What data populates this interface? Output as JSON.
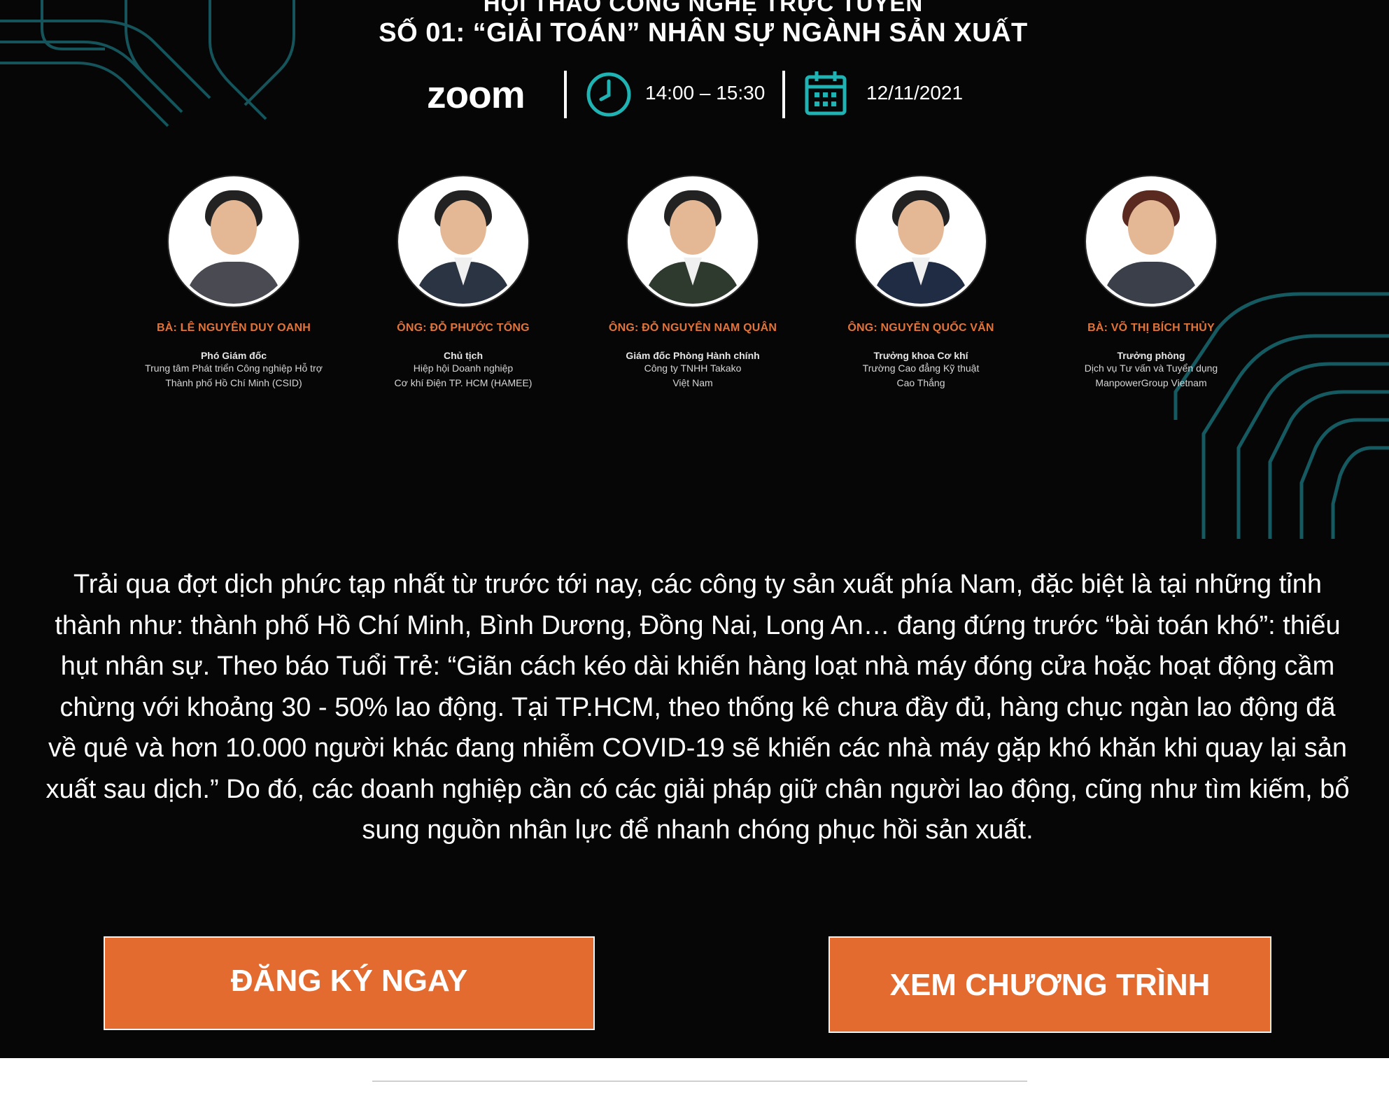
{
  "event": {
    "kicker": "HỘI THẢO CÔNG NGHỆ TRỰC TUYẾN",
    "title": "SỐ 01: “GIẢI TOÁN” NHÂN SỰ NGÀNH SẢN XUẤT",
    "platform": "zoom",
    "time": "14:00 – 15:30",
    "date": "12/11/2021"
  },
  "speakers": [
    {
      "name": "BÀ: LÊ NGUYÊN DUY OANH",
      "role": "Phó Giám đốc",
      "org_line1": "Trung tâm Phát triển Công nghiệp Hỗ trợ",
      "org_line2": "Thành phố Hồ Chí Minh (CSID)"
    },
    {
      "name": "ÔNG: ĐỖ PHƯỚC TỐNG",
      "role": "Chủ tịch",
      "org_line1": "Hiệp hội Doanh nghiệp",
      "org_line2": "Cơ khí Điện TP. HCM (HAMEE)"
    },
    {
      "name": "ÔNG: ĐỖ NGUYÊN NAM QUÂN",
      "role": "Giám đốc Phòng Hành chính",
      "org_line1": "Công ty TNHH Takako",
      "org_line2": "Việt Nam"
    },
    {
      "name": "ÔNG: NGUYỄN QUỐC VĂN",
      "role": "Trưởng khoa Cơ khí",
      "org_line1": "Trường Cao đẳng Kỹ thuật",
      "org_line2": "Cao Thắng"
    },
    {
      "name": "BÀ: VÕ THỊ BÍCH THỦY",
      "role": "Trưởng phòng",
      "org_line1": "Dịch vụ Tư vấn và Tuyển dụng",
      "org_line2": "ManpowerGroup Vietnam"
    }
  ],
  "intro_text": "Trải qua đợt dịch phức tạp nhất từ trước tới nay, các công ty sản xuất phía Nam, đặc biệt là tại những tỉnh thành như: thành phố Hồ Chí Minh, Bình Dương, Đồng Nai, Long An… đang đứng trước “bài toán khó”: thiếu hụt nhân sự. Theo báo Tuổi Trẻ: “Giãn cách kéo dài khiến hàng loạt nhà máy đóng cửa hoặc hoạt động cầm chừng với khoảng 30 - 50% lao động. Tại TP.HCM, theo thống kê chưa đầy đủ, hàng chục ngàn lao động đã về quê và hơn 10.000 người khác đang nhiễm COVID-19 sẽ khiến các nhà máy gặp khó khăn khi quay lại sản xuất sau dịch.” Do đó, các doanh nghiệp cần có các giải pháp giữ chân người lao động, cũng như tìm kiếm, bổ sung nguồn nhân lực để nhanh chóng phục hồi sản xuất.",
  "buttons": {
    "register": "ĐĂNG KÝ NGAY",
    "program": "XEM CHƯƠNG TRÌNH"
  },
  "colors": {
    "banner_bg": "#060606",
    "accent_orange": "#e36b2f",
    "accent_teal": "#1fb3b3"
  },
  "icons": [
    "clock-icon",
    "calendar-icon",
    "zoom-logo"
  ]
}
